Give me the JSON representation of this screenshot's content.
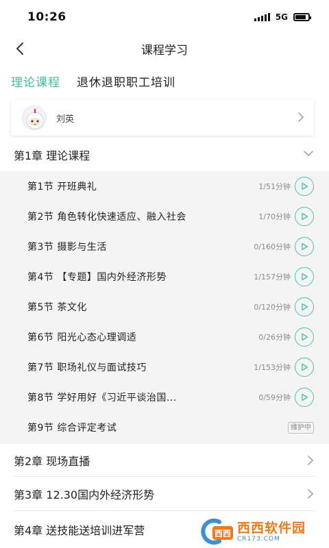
{
  "status_bar": {
    "time": "10:26",
    "network": "5G",
    "battery_level": 0.85
  },
  "nav": {
    "title": "课程学习",
    "back_icon": "chevron-left-icon"
  },
  "tabs": [
    {
      "label": "理论课程",
      "active": true
    },
    {
      "label": "退休退职职工培训",
      "active": false
    }
  ],
  "user": {
    "name": "刘英",
    "avatar_icon": "avatar-icon"
  },
  "chapters": [
    {
      "title": "第1章 理论课程",
      "expanded": true
    },
    {
      "title": "第2章 现场直播",
      "expanded": false
    },
    {
      "title": "第3章 12.30国内外经济形势",
      "expanded": false
    },
    {
      "title": "第4章 送技能送培训进军营",
      "expanded": false
    }
  ],
  "lessons": [
    {
      "title": "第1节 开班典礼",
      "duration": "1/51分钟",
      "action": "play-icon"
    },
    {
      "title": "第2节 角色转化快速适应、融入社会",
      "duration": "1/70分钟",
      "action": "play-icon"
    },
    {
      "title": "第3节 摄影与生活",
      "duration": "0/160分钟",
      "action": "play-icon"
    },
    {
      "title": "第4节 【专题】国内外经济形势",
      "duration": "1/157分钟",
      "action": "play-icon"
    },
    {
      "title": "第5节 茶文化",
      "duration": "0/120分钟",
      "action": "play-icon"
    },
    {
      "title": "第6节 阳光心态心理调适",
      "duration": "0/26分钟",
      "action": "play-icon"
    },
    {
      "title": "第7节 职场礼仪与面试技巧",
      "duration": "1/153分钟",
      "action": "play-icon"
    },
    {
      "title": "第8节 学好用好《习近平谈治国...",
      "duration": "0/59分钟",
      "action": "play-icon"
    },
    {
      "title": "第9节 综合评定考试",
      "badge": "维护中"
    }
  ],
  "watermark": {
    "brand": "西西软件园",
    "site": "CR173.COM"
  },
  "colors": {
    "accent": "#3dbfa4",
    "play_button": "#46c6ab",
    "lesson_bg": "#f4f4f4",
    "watermark_orange": "#f07a1a",
    "watermark_blue": "#3a8fd6"
  }
}
